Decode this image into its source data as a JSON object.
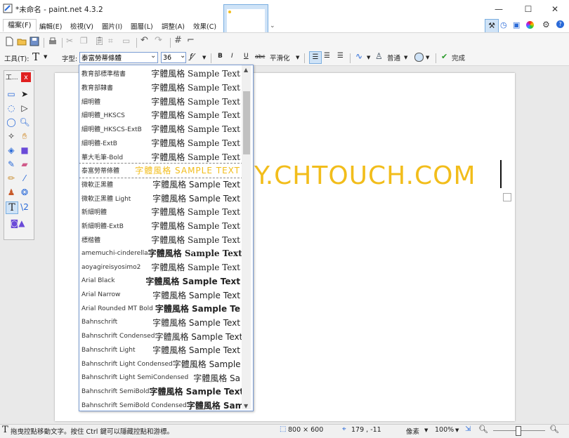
{
  "window": {
    "title": "*未命名 - paint.net 4.3.2",
    "minimize_glyph": "—",
    "maximize_glyph": "☐",
    "close_glyph": "✕"
  },
  "menu": {
    "items": [
      "檔案(F)",
      "編輯(E)",
      "檢視(V)",
      "圖片(I)",
      "圖層(L)",
      "調整(A)",
      "效果(C)"
    ]
  },
  "toolbar2": {
    "tool_label": "工具(T):",
    "font_label": "字型:",
    "font_value": "泰富勞蒂條體",
    "size_value": "36",
    "bold": "B",
    "italic": "I",
    "underline": "U",
    "strike": "abc",
    "smoothing": "平滑化",
    "blend": "普通",
    "finish": "完成"
  },
  "tools_panel": {
    "title": "工...",
    "close": "x"
  },
  "canvas": {
    "text": "Y.CHTOUCH.COM",
    "text_color": "#f2bd1b"
  },
  "font_list": [
    {
      "name": "教育部標準楷書",
      "sample": "字體風格 Sample Text"
    },
    {
      "name": "教育部隸書",
      "sample": "字體風格 Sample Text"
    },
    {
      "name": "細明體",
      "sample": "字體風格 Sample Text"
    },
    {
      "name": "細明體_HKSCS",
      "sample": "字體風格 Sample Text"
    },
    {
      "name": "細明體_HKSCS-ExtB",
      "sample": "字體風格 Sample Text"
    },
    {
      "name": "細明體-ExtB",
      "sample": "字體風格 Sample Text"
    },
    {
      "name": "華大毛筆-Bold",
      "sample": "字體風格 Sample Text"
    },
    {
      "name": "泰富勞蒂條體",
      "sample": "字體風格 SAMPLE TEXT"
    },
    {
      "name": "微軟正黑體",
      "sample": "字體風格 Sample Text"
    },
    {
      "name": "微軟正黑體 Light",
      "sample": "字體風格 Sample Text"
    },
    {
      "name": "新細明體",
      "sample": "字體風格 Sample Text"
    },
    {
      "name": "新細明體-ExtB",
      "sample": "字體風格 Sample Text"
    },
    {
      "name": "標楷體",
      "sample": "字體風格 Sample Text"
    },
    {
      "name": "amemuchi-cinderella",
      "sample": "字體風格 Sample Text"
    },
    {
      "name": "aoyagireisyosimo2",
      "sample": "字體風格 Sample Text"
    },
    {
      "name": "Arial Black",
      "sample": "字體風格 Sample Text"
    },
    {
      "name": "Arial Narrow",
      "sample": "字體風格 Sample Text"
    },
    {
      "name": "Arial Rounded MT Bold",
      "sample": "字體風格 Sample Te"
    },
    {
      "name": "Bahnschrift",
      "sample": "字體風格 Sample Text"
    },
    {
      "name": "Bahnschrift Condensed",
      "sample": "字體風格 Sample Text"
    },
    {
      "name": "Bahnschrift Light",
      "sample": "字體風格 Sample Text"
    },
    {
      "name": "Bahnschrift Light Condensed",
      "sample": "字體風格 Sample T"
    },
    {
      "name": "Bahnschrift Light SemiCondensed",
      "sample": "字體風格 Sa"
    },
    {
      "name": "Bahnschrift SemiBold",
      "sample": "字體風格 Sample Text"
    },
    {
      "name": "Bahnschrift SemiBold Condensed",
      "sample": "字體風格 Sam"
    }
  ],
  "status": {
    "hint": "拖曳控點移動文字。按住 Ctrl 鍵可以隱藏控點和游標。",
    "size": "800 × 600",
    "coords": "179 , -11",
    "unit": "像素",
    "zoom": "100%"
  }
}
